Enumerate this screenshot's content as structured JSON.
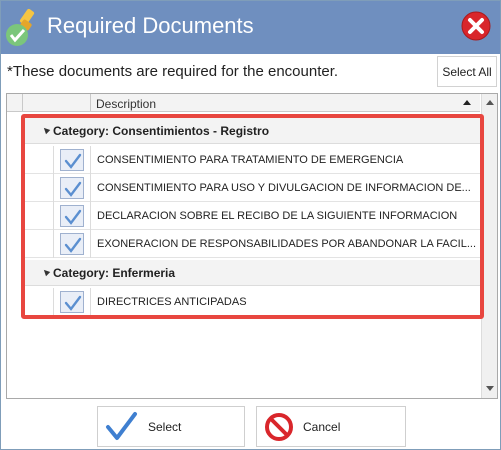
{
  "dialog": {
    "title": "Required Documents",
    "instruction": "*These documents are required for the encounter.",
    "select_all_label": "Select All"
  },
  "grid": {
    "column_header": "Description",
    "groups": [
      {
        "label": "Category: Consentimientos - Registro",
        "items": [
          {
            "label": "CONSENTIMIENTO PARA TRATAMIENTO DE EMERGENCIA",
            "checked": true
          },
          {
            "label": "CONSENTIMIENTO PARA USO Y DIVULGACION DE INFORMACION DE...",
            "checked": true
          },
          {
            "label": "DECLARACION SOBRE EL RECIBO DE LA SIGUIENTE INFORMACION",
            "checked": true
          },
          {
            "label": "EXONERACION DE RESPONSABILIDADES POR ABANDONAR LA FACIL...",
            "checked": true
          }
        ]
      },
      {
        "label": "Category: Enfermeria",
        "items": [
          {
            "label": "DIRECTRICES ANTICIPADAS",
            "checked": true
          }
        ]
      }
    ]
  },
  "buttons": {
    "select_label": "Select",
    "cancel_label": "Cancel"
  },
  "colors": {
    "titlebar": "#6f8fbf",
    "highlight": "#e8463f",
    "check": "#5b8fd0"
  },
  "icons": [
    "app-icon",
    "close-icon",
    "checkmark-icon",
    "cancel-icon",
    "sort-ascending-icon",
    "expand-arrow-icon"
  ]
}
